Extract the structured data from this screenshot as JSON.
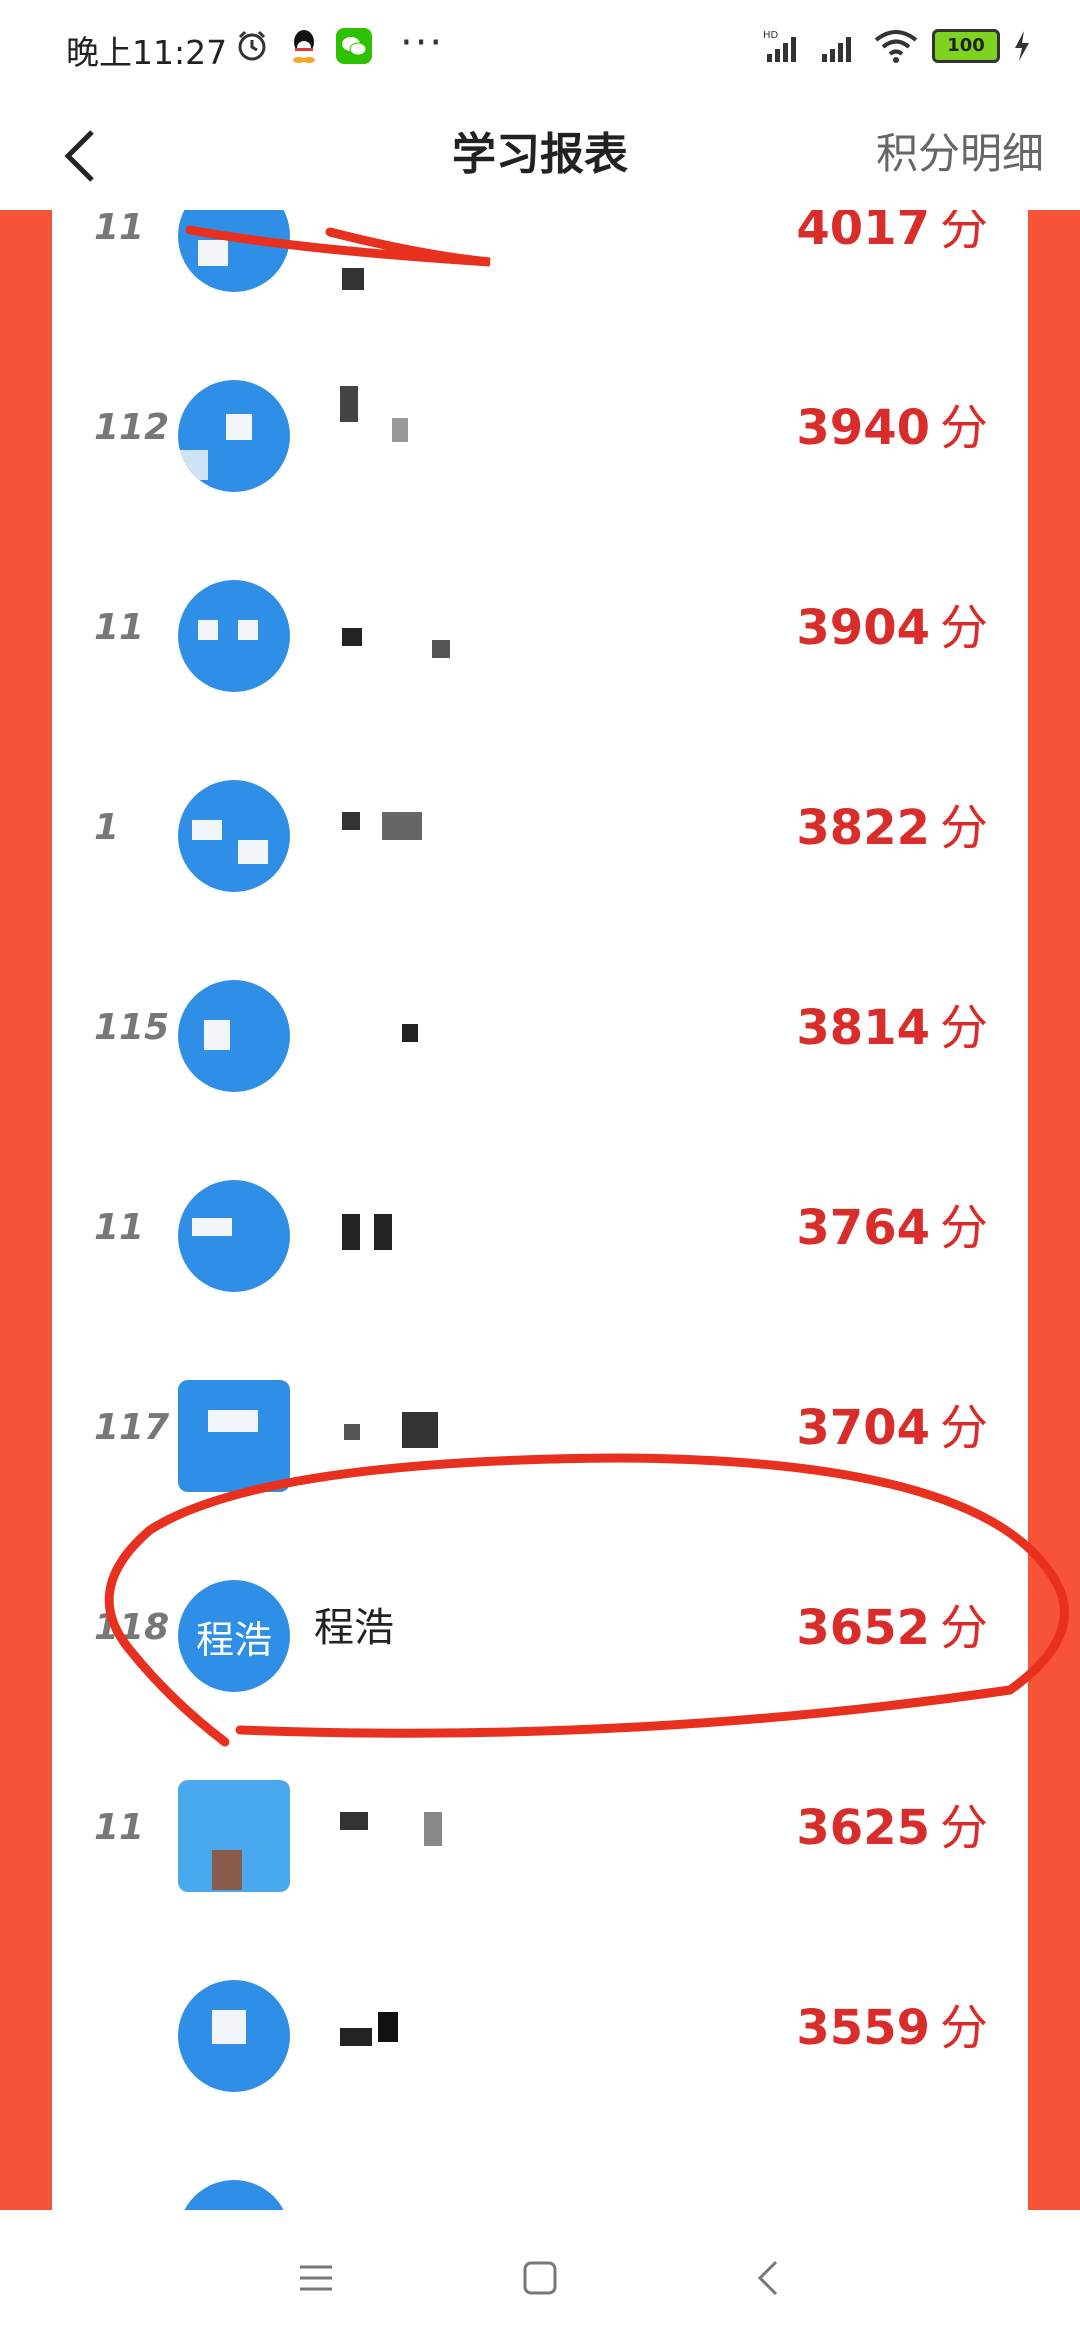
{
  "status_bar": {
    "time": "晚上11:27",
    "battery": "100"
  },
  "nav": {
    "title": "学习报表",
    "right_label": "积分明细"
  },
  "ranking": {
    "unit": "分",
    "rows": [
      {
        "rank": "11",
        "name": "",
        "score": "4017"
      },
      {
        "rank": "112",
        "name": "",
        "score": "3940"
      },
      {
        "rank": "11",
        "name": "",
        "score": "3904"
      },
      {
        "rank": "1",
        "name": "",
        "score": "3822"
      },
      {
        "rank": "115",
        "name": "",
        "score": "3814"
      },
      {
        "rank": "11",
        "name": "",
        "score": "3764"
      },
      {
        "rank": "117",
        "name": "",
        "score": "3704"
      },
      {
        "rank": "118",
        "name": "程浩",
        "avatar_text": "程浩",
        "score": "3652"
      },
      {
        "rank": "11",
        "name": "",
        "score": "3625"
      },
      {
        "rank": "",
        "name": "",
        "score": "3559"
      }
    ]
  },
  "colors": {
    "accent_red": "#d82d2a",
    "side_panel": "#f65339",
    "avatar_blue": "#2f8fe6"
  }
}
